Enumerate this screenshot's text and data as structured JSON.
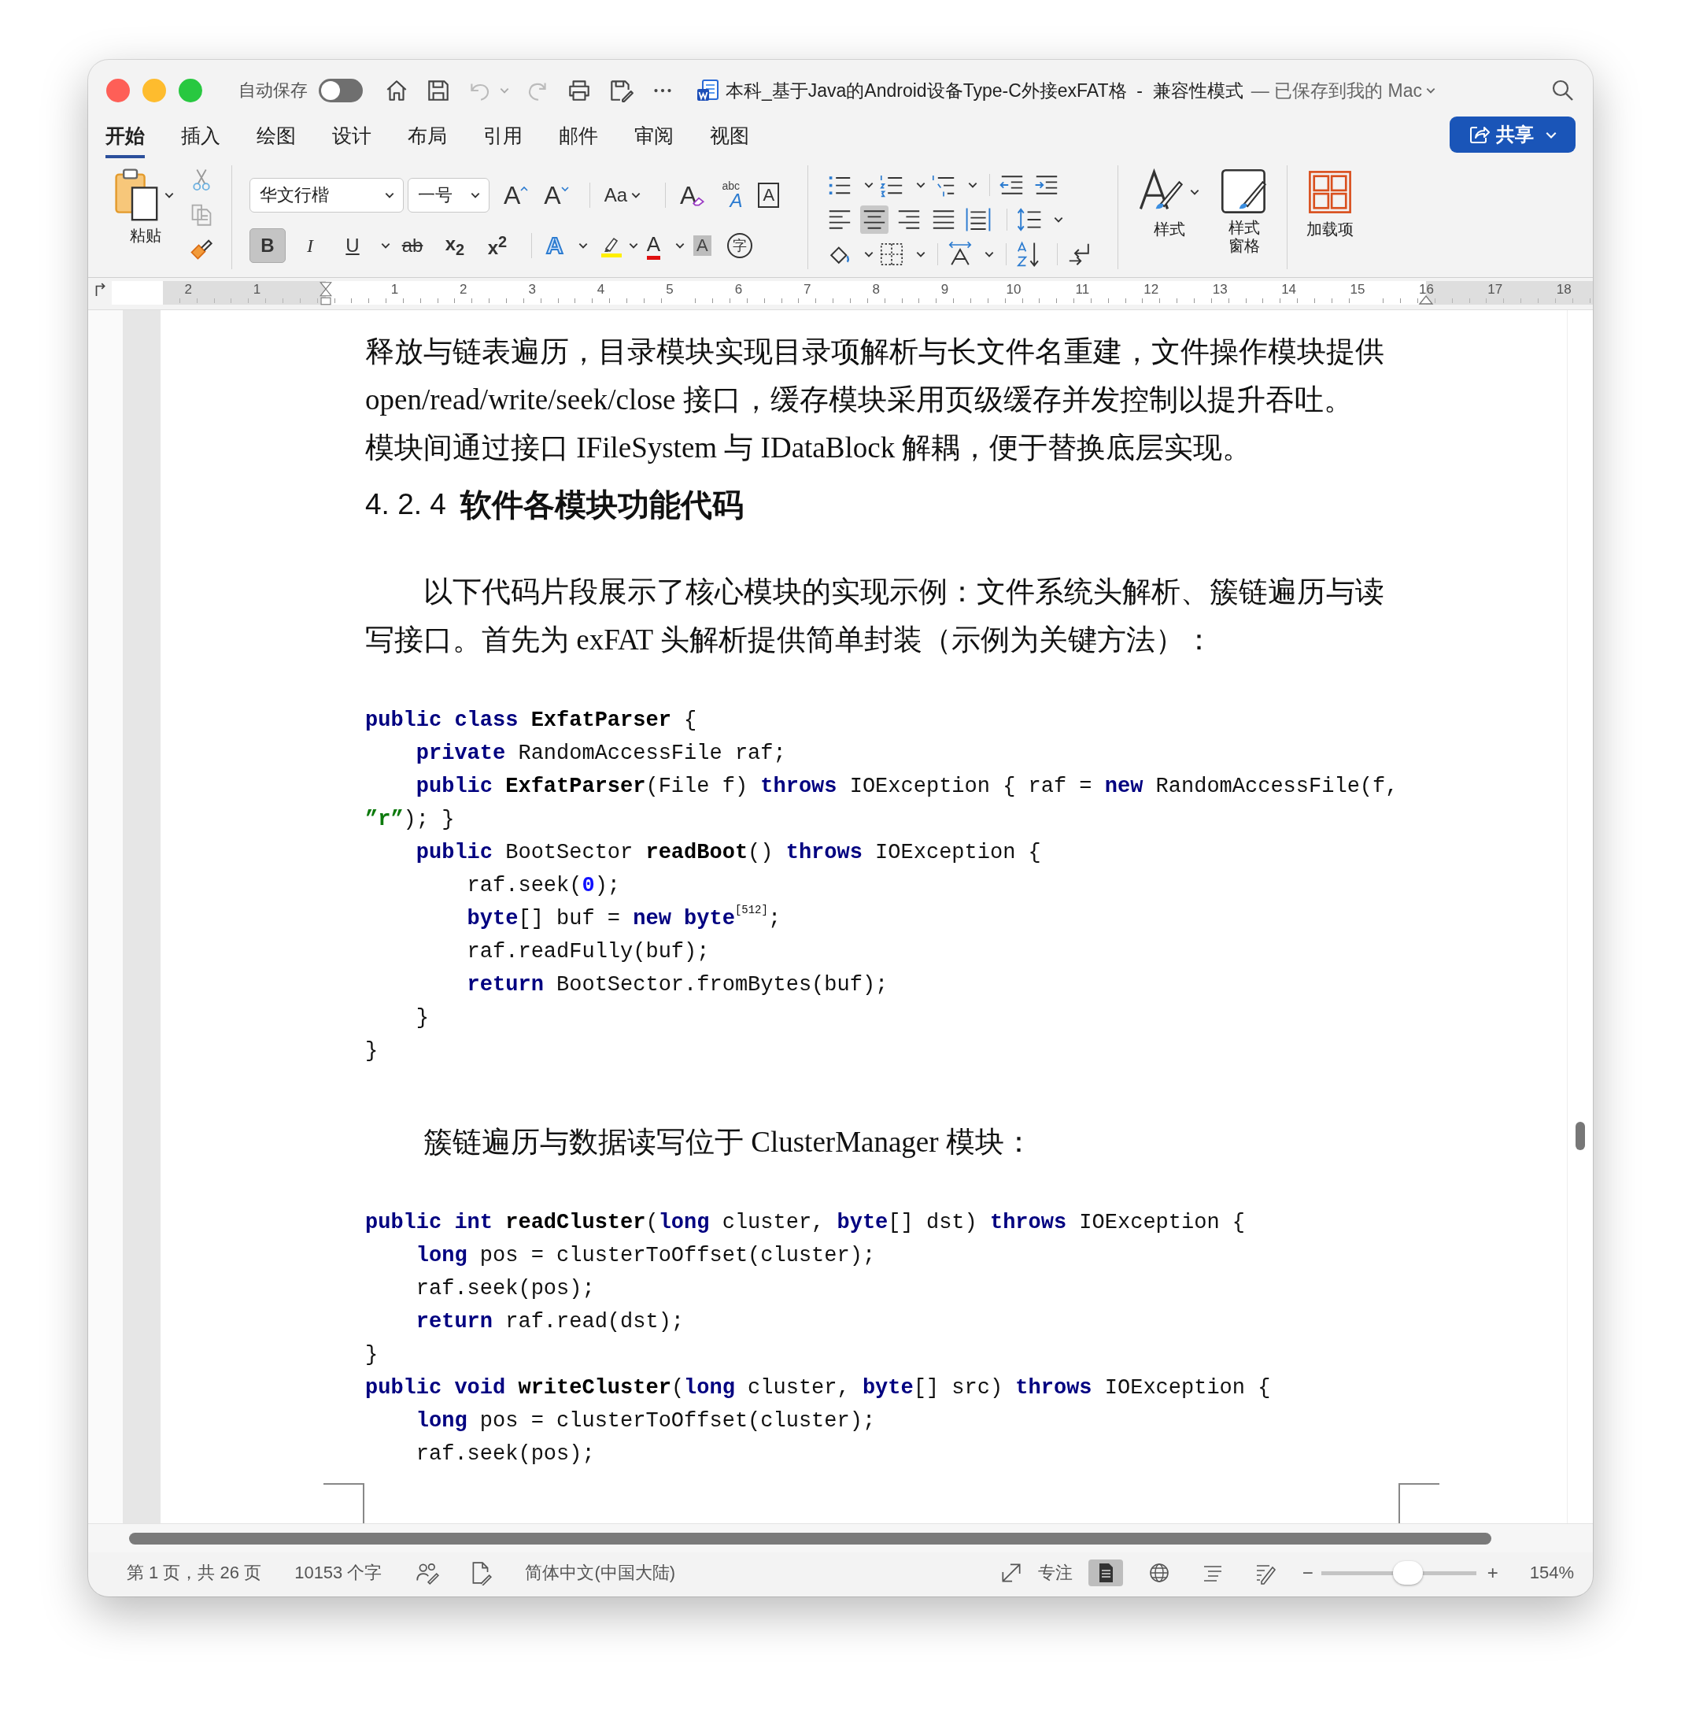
{
  "window": {
    "title": "本科_基于Java的Android设备Type-C外接exFAT格  -  兼容性模式",
    "save_status": "— 已保存到我的 Mac"
  },
  "toolbar": {
    "autosave_label": "自动保存",
    "autosave_on": false,
    "undo_disabled": true,
    "redo_disabled": true
  },
  "tabs": [
    {
      "label": "开始",
      "selected": true
    },
    {
      "label": "插入",
      "selected": false
    },
    {
      "label": "绘图",
      "selected": false
    },
    {
      "label": "设计",
      "selected": false
    },
    {
      "label": "布局",
      "selected": false
    },
    {
      "label": "引用",
      "selected": false
    },
    {
      "label": "邮件",
      "selected": false
    },
    {
      "label": "审阅",
      "selected": false
    },
    {
      "label": "视图",
      "selected": false
    }
  ],
  "share": {
    "label": "共享"
  },
  "ribbon": {
    "paste_label": "粘贴",
    "font_name": "华文行楷",
    "font_size": "一号",
    "font_row1": [
      {
        "kind": "grow",
        "label": "A"
      },
      {
        "kind": "shrink",
        "label": "A"
      },
      {
        "kind": "case",
        "label": "Aa"
      },
      {
        "kind": "clear",
        "label": "A"
      },
      {
        "kind": "effect-abc",
        "top": "abc",
        "label": "A"
      },
      {
        "kind": "border",
        "label": "A"
      }
    ],
    "font_row2": [
      {
        "kind": "bold",
        "label": "B",
        "selected": true
      },
      {
        "kind": "italic",
        "label": "I",
        "selected": false
      },
      {
        "kind": "underline",
        "label": "U",
        "selected": false
      },
      {
        "kind": "strike",
        "label": "ab",
        "selected": false
      },
      {
        "kind": "sub",
        "label": "x$_{2}$",
        "selected": false
      },
      {
        "kind": "sup",
        "label": "x$^{2}$",
        "selected": false
      },
      {
        "kind": "effects",
        "label": "A"
      },
      {
        "kind": "highlight"
      },
      {
        "kind": "color",
        "label": "A"
      },
      {
        "kind": "shading",
        "label": "A"
      },
      {
        "kind": "phonetic",
        "label": "字"
      }
    ],
    "para_rows": [
      [
        {
          "kind": "bullets"
        },
        {
          "kind": "numbering"
        },
        {
          "kind": "multilevel"
        },
        {
          "kind": "sep"
        },
        {
          "kind": "outdent"
        },
        {
          "kind": "indent"
        }
      ],
      [
        {
          "kind": "align-left",
          "selected": false
        },
        {
          "kind": "align-center",
          "selected": true
        },
        {
          "kind": "align-right",
          "selected": false
        },
        {
          "kind": "justify",
          "selected": false
        },
        {
          "kind": "distribute",
          "selected": false
        },
        {
          "kind": "sep"
        },
        {
          "kind": "spacing"
        }
      ],
      [
        {
          "kind": "fill"
        },
        {
          "kind": "borders"
        },
        {
          "kind": "sep"
        },
        {
          "kind": "asian"
        },
        {
          "kind": "sep"
        },
        {
          "kind": "sort"
        },
        {
          "kind": "sep"
        },
        {
          "kind": "marks"
        }
      ]
    ],
    "styles": [
      {
        "kind": "styles",
        "label": "样式"
      },
      {
        "kind": "pane",
        "label": "样式窗格"
      }
    ],
    "addins": "加载项"
  },
  "ruler": {
    "left_labels": [
      "2",
      "1"
    ],
    "labels": [
      "1",
      "2",
      "3",
      "4",
      "5",
      "6",
      "7",
      "8",
      "9",
      "10",
      "11",
      "12",
      "13",
      "14",
      "15",
      "16",
      "17",
      "18"
    ]
  },
  "document": {
    "blocks": [
      {
        "kind": "para",
        "indent": false,
        "lines": [
          "释放与链表遍历，目录模块实现目录项解析与长文件名重建，文件操作模块提供",
          "open/read/write/seek/close 接口，缓存模块采用页级缓存并发控制以提升吞吐。",
          "模块间通过接口 IFileSystem 与 IDataBlock 解耦，便于替换底层实现。"
        ]
      },
      {
        "kind": "heading",
        "number": "4. 2. 4",
        "title": "软件各模块功能代码"
      },
      {
        "kind": "para",
        "indent": true,
        "lines": [
          "以下代码片段展示了核心模块的实现示例：文件系统头解析、簇链遍历与读",
          "写接口。首先为 exFAT 头解析提供简单封装（示例为关键方法）："
        ]
      },
      {
        "kind": "code",
        "lines": [
          [
            {
              "kind": "kw",
              "text": "public class "
            },
            {
              "kind": "id",
              "text": "ExfatParser"
            },
            {
              "kind": "txt",
              "text": " {"
            }
          ],
          [
            {
              "kind": "kw",
              "text": "    private"
            },
            {
              "kind": "txt",
              "text": " RandomAccessFile raf;"
            }
          ],
          [
            {
              "kind": "kw",
              "text": "    public "
            },
            {
              "kind": "id",
              "text": "ExfatParser"
            },
            {
              "kind": "txt",
              "text": "(File f) "
            },
            {
              "kind": "kw",
              "text": "throws"
            },
            {
              "kind": "txt",
              "text": " IOException { raf = "
            },
            {
              "kind": "kw",
              "text": "new"
            },
            {
              "kind": "txt",
              "text": " RandomAccessFile(f,"
            }
          ],
          [
            {
              "kind": "str",
              "text": "”r”"
            },
            {
              "kind": "txt",
              "text": "); }"
            }
          ],
          [
            {
              "kind": "kw",
              "text": "    public"
            },
            {
              "kind": "txt",
              "text": " BootSector "
            },
            {
              "kind": "id",
              "text": "readBoot"
            },
            {
              "kind": "txt",
              "text": "() "
            },
            {
              "kind": "kw",
              "text": "throws"
            },
            {
              "kind": "txt",
              "text": " IOException {"
            }
          ],
          [
            {
              "kind": "txt",
              "text": "        raf.seek("
            },
            {
              "kind": "num",
              "text": "0"
            },
            {
              "kind": "txt",
              "text": ");"
            }
          ],
          [
            {
              "kind": "kw",
              "text": "        byte"
            },
            {
              "kind": "txt",
              "text": "[] buf = "
            },
            {
              "kind": "kw",
              "text": "new byte"
            },
            {
              "kind": "sup",
              "text": "[512]"
            },
            {
              "kind": "txt",
              "text": ";"
            }
          ],
          [
            {
              "kind": "txt",
              "text": "        raf.readFully(buf);"
            }
          ],
          [
            {
              "kind": "kw",
              "text": "        return"
            },
            {
              "kind": "txt",
              "text": " BootSector.fromBytes(buf);"
            }
          ],
          [
            {
              "kind": "txt",
              "text": "    }"
            }
          ],
          [
            {
              "kind": "txt",
              "text": "}"
            }
          ]
        ]
      },
      {
        "kind": "para",
        "indent": true,
        "lines": [
          "簇链遍历与数据读写位于 ClusterManager 模块："
        ]
      },
      {
        "kind": "code",
        "lines": [
          [
            {
              "kind": "kw",
              "text": "public int "
            },
            {
              "kind": "id",
              "text": "readCluster"
            },
            {
              "kind": "txt",
              "text": "("
            },
            {
              "kind": "kw",
              "text": "long"
            },
            {
              "kind": "txt",
              "text": " cluster, "
            },
            {
              "kind": "kw",
              "text": "byte"
            },
            {
              "kind": "txt",
              "text": "[] dst) "
            },
            {
              "kind": "kw",
              "text": "throws"
            },
            {
              "kind": "txt",
              "text": " IOException {"
            }
          ],
          [
            {
              "kind": "kw",
              "text": "    long"
            },
            {
              "kind": "txt",
              "text": " pos = clusterToOffset(cluster);"
            }
          ],
          [
            {
              "kind": "txt",
              "text": "    raf.seek(pos);"
            }
          ],
          [
            {
              "kind": "kw",
              "text": "    return"
            },
            {
              "kind": "txt",
              "text": " raf.read(dst);"
            }
          ],
          [
            {
              "kind": "txt",
              "text": "}"
            }
          ],
          [
            {
              "kind": "kw",
              "text": "public void "
            },
            {
              "kind": "id",
              "text": "writeCluster"
            },
            {
              "kind": "txt",
              "text": "("
            },
            {
              "kind": "kw",
              "text": "long"
            },
            {
              "kind": "txt",
              "text": " cluster, "
            },
            {
              "kind": "kw",
              "text": "byte"
            },
            {
              "kind": "txt",
              "text": "[] src) "
            },
            {
              "kind": "kw",
              "text": "throws"
            },
            {
              "kind": "txt",
              "text": " IOException {"
            }
          ],
          [
            {
              "kind": "kw",
              "text": "    long"
            },
            {
              "kind": "txt",
              "text": " pos = clusterToOffset(cluster);"
            }
          ],
          [
            {
              "kind": "txt",
              "text": "    raf.seek(pos);"
            }
          ]
        ]
      }
    ]
  },
  "status_bar": {
    "page": "第 1 页，共 26 页",
    "words": "10153 个字",
    "language": "简体中文(中国大陆)",
    "focus": "专注",
    "views": [
      {
        "kind": "print",
        "selected": true
      },
      {
        "kind": "web",
        "selected": false
      },
      {
        "kind": "outline",
        "selected": false
      },
      {
        "kind": "draft",
        "selected": false
      }
    ],
    "zoom_minus": "−",
    "zoom_plus": "+",
    "zoom": {
      "level": 0.56
    },
    "zoom_label": "154%"
  }
}
